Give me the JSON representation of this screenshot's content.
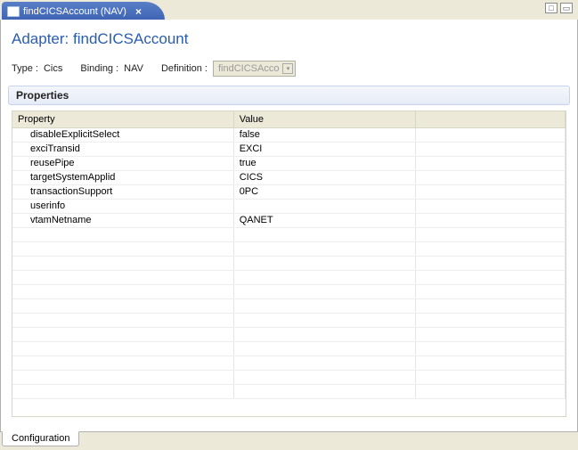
{
  "tab": {
    "title": "findCICSAccount (NAV)"
  },
  "header": {
    "prefix": "Adapter: ",
    "name": "findCICSAccount"
  },
  "meta": {
    "typeLabel": "Type :",
    "typeValue": "Cics",
    "bindingLabel": "Binding :",
    "bindingValue": "NAV",
    "definitionLabel": "Definition :",
    "definitionValue": "findCICSAcco"
  },
  "section": {
    "title": "Properties"
  },
  "table": {
    "columns": {
      "c0": "Property",
      "c1": "Value",
      "c2": ""
    },
    "rows": [
      {
        "prop": "disableExplicitSelect",
        "val": "false"
      },
      {
        "prop": "exciTransid",
        "val": "EXCI"
      },
      {
        "prop": "reusePipe",
        "val": "true"
      },
      {
        "prop": "targetSystemApplid",
        "val": "CICS"
      },
      {
        "prop": "transactionSupport",
        "val": "0PC"
      },
      {
        "prop": "userinfo",
        "val": ""
      },
      {
        "prop": "vtamNetname",
        "val": "QANET"
      }
    ]
  },
  "bottomTab": {
    "label": "Configuration"
  }
}
